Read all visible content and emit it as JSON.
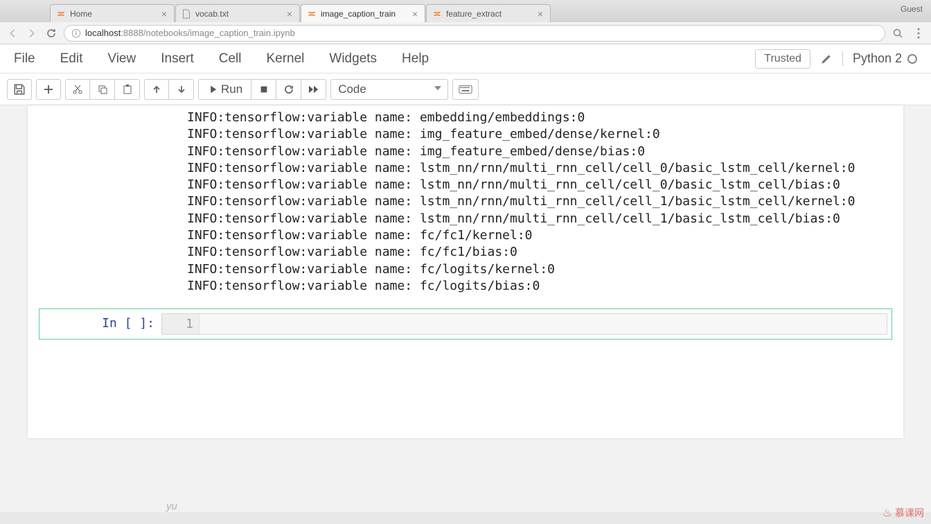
{
  "browser": {
    "guest": "Guest",
    "tabs": [
      {
        "title": "Home",
        "icon": "jupyter"
      },
      {
        "title": "vocab.txt",
        "icon": "file"
      },
      {
        "title": "image_caption_train",
        "icon": "jupyter",
        "active": true
      },
      {
        "title": "feature_extract",
        "icon": "jupyter"
      }
    ],
    "url_host": "localhost",
    "url_port": ":8888",
    "url_path": "/notebooks/image_caption_train.ipynb"
  },
  "menu": {
    "items": [
      "File",
      "Edit",
      "View",
      "Insert",
      "Cell",
      "Kernel",
      "Widgets",
      "Help"
    ],
    "trusted": "Trusted",
    "kernel": "Python 2"
  },
  "toolbar": {
    "run_label": "Run",
    "celltype_selected": "Code"
  },
  "output_lines": [
    "INFO:tensorflow:variable name: embedding/embeddings:0",
    "INFO:tensorflow:variable name: img_feature_embed/dense/kernel:0",
    "INFO:tensorflow:variable name: img_feature_embed/dense/bias:0",
    "INFO:tensorflow:variable name: lstm_nn/rnn/multi_rnn_cell/cell_0/basic_lstm_cell/kernel:0",
    "INFO:tensorflow:variable name: lstm_nn/rnn/multi_rnn_cell/cell_0/basic_lstm_cell/bias:0",
    "INFO:tensorflow:variable name: lstm_nn/rnn/multi_rnn_cell/cell_1/basic_lstm_cell/kernel:0",
    "INFO:tensorflow:variable name: lstm_nn/rnn/multi_rnn_cell/cell_1/basic_lstm_cell/bias:0",
    "INFO:tensorflow:variable name: fc/fc1/kernel:0",
    "INFO:tensorflow:variable name: fc/fc1/bias:0",
    "INFO:tensorflow:variable name: fc/logits/kernel:0",
    "INFO:tensorflow:variable name: fc/logits/bias:0"
  ],
  "cell": {
    "prompt": "In [ ]:",
    "line_number": "1"
  },
  "footer": "yu",
  "watermark": "慕课网"
}
